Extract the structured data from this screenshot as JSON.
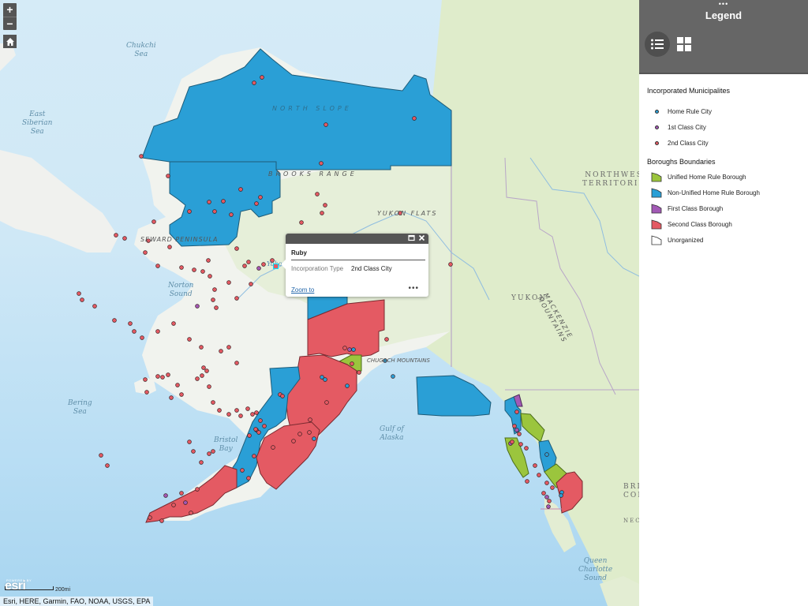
{
  "map": {
    "controls": {
      "zoom_in_label": "+",
      "zoom_out_label": "−",
      "home_icon": "home-icon"
    },
    "labels": {
      "water": [
        {
          "id": "chukchi",
          "text": "Chukchi\nSea"
        },
        {
          "id": "east_siberian",
          "text": "East\nSiberian\nSea"
        },
        {
          "id": "norton",
          "text": "Norton\nSound"
        },
        {
          "id": "bering",
          "text": "Bering\nSea"
        },
        {
          "id": "bristol",
          "text": "Bristol\nBay"
        },
        {
          "id": "gulf",
          "text": "Gulf of\nAlaska"
        },
        {
          "id": "queen",
          "text": "Queen\nCharlotte\nSound"
        }
      ],
      "land": [
        {
          "id": "nwt",
          "text": "NORTHWEST\nTERRITORIES"
        },
        {
          "id": "yukon",
          "text": "YUKON"
        },
        {
          "id": "bc",
          "text": "BRI\nCOL"
        },
        {
          "id": "nech",
          "text": "NECH"
        }
      ],
      "regions": [
        {
          "id": "north_slope",
          "text": "NORTH SLOPE"
        },
        {
          "id": "brooks",
          "text": "BROOKS RANGE"
        },
        {
          "id": "seward",
          "text": "SEWARD PENINSULA"
        },
        {
          "id": "yukon_flats",
          "text": "YUKON FLATS"
        },
        {
          "id": "chugach",
          "text": "CHUGACH MOUNTAINS"
        },
        {
          "id": "mackenzie",
          "text": "MACKENZIE MOUNTAINS"
        },
        {
          "id": "yukon_river",
          "text": "Yukon"
        }
      ]
    },
    "popup": {
      "title": "Ruby",
      "field_label": "Incorporation Type",
      "field_value": "2nd Class City",
      "zoom_link": "Zoom to",
      "more_label": "•••",
      "maximize_icon": "maximize-icon",
      "close_icon": "close-icon"
    },
    "attribution": {
      "powered_by": "POWERED BY",
      "logo_text": "esri",
      "scale_label": "200mi",
      "credits": "Esri, HERE, Garmin, FAO, NOAA, USGS, EPA"
    }
  },
  "legend": {
    "drag_handle": "•••",
    "title": "Legend",
    "view_buttons": [
      {
        "name": "list-view",
        "active": true
      },
      {
        "name": "grid-view",
        "active": false
      }
    ],
    "sections": [
      {
        "title": "Incorporated Municipalites",
        "items": [
          {
            "label": "Home Rule City",
            "color": "#2a9fd6",
            "shape": "dot"
          },
          {
            "label": "1st Class City",
            "color": "#a259b5",
            "shape": "dot"
          },
          {
            "label": "2nd Class City",
            "color": "#e45a63",
            "shape": "dot"
          }
        ]
      },
      {
        "title": "Boroughs Boundaries",
        "items": [
          {
            "label": "Unified Home Rule Borough",
            "color": "#9bc53d",
            "shape": "polygon"
          },
          {
            "label": "Non-Unified Home Rule Borough",
            "color": "#2a9fd6",
            "shape": "polygon"
          },
          {
            "label": "First Class Borough",
            "color": "#a259b5",
            "shape": "polygon"
          },
          {
            "label": "Second Class Borough",
            "color": "#e45a63",
            "shape": "polygon"
          },
          {
            "label": "Unorganized",
            "color": "#ffffff",
            "shape": "polygon"
          }
        ]
      }
    ]
  },
  "colors": {
    "home_rule": "#2a9fd6",
    "first_class": "#a259b5",
    "second_class": "#e45a63",
    "unified": "#9bc53d",
    "panel_header": "#666666"
  }
}
